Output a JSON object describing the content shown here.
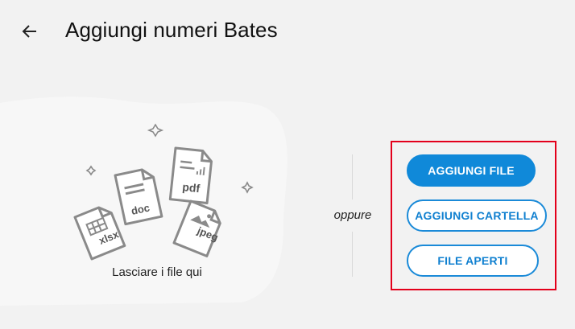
{
  "header": {
    "back_icon": "arrow-left-icon",
    "title": "Aggiungi numeri Bates"
  },
  "dropzone": {
    "label": "Lasciare i file qui",
    "file_types": [
      "xlsx",
      "doc",
      "pdf",
      "jpeg"
    ]
  },
  "separator": {
    "label": "oppure"
  },
  "actions": {
    "add_file": "AGGIUNGI FILE",
    "add_folder": "AGGIUNGI CARTELLA",
    "open_files": "FILE APERTI"
  },
  "colors": {
    "primary": "#1089d9",
    "highlight": "#e3001b",
    "icon_gray": "#8a8a8a"
  }
}
